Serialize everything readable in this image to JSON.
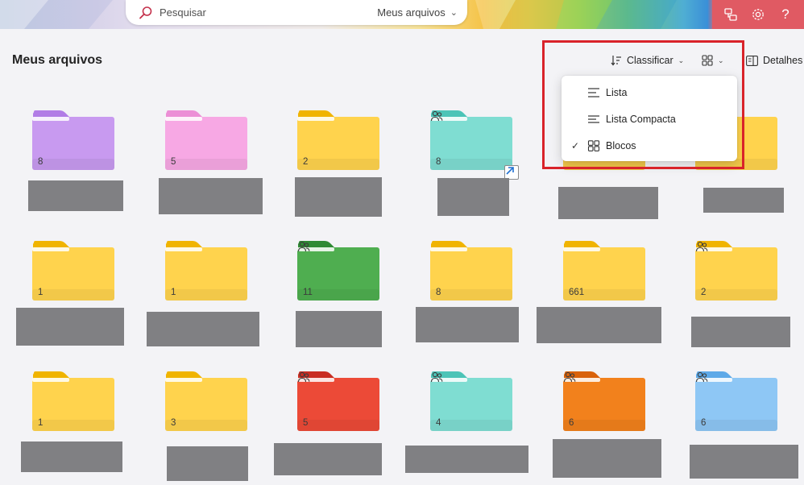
{
  "header": {
    "search_placeholder": "Pesquisar",
    "search_scope": "Meus arquivos",
    "actions": [
      "share-feedback-icon",
      "gear-icon",
      "help-icon"
    ]
  },
  "page": {
    "title": "Meus arquivos"
  },
  "commands": {
    "sort_label": "Classificar",
    "details_label": "Detalhes"
  },
  "view_menu": {
    "items": [
      {
        "label": "Lista",
        "icon": "list-icon",
        "checked": false
      },
      {
        "label": "Lista Compacta",
        "icon": "compact-list-icon",
        "checked": false
      },
      {
        "label": "Blocos",
        "icon": "tiles-icon",
        "checked": true
      }
    ]
  },
  "folders": [
    {
      "count": "8",
      "color": "#c89af0",
      "tab": "#b27de6",
      "shared": false
    },
    {
      "count": "5",
      "color": "#f7a8e4",
      "tab": "#ec8fd6",
      "shared": false
    },
    {
      "count": "2",
      "color": "#ffd34d",
      "tab": "#f0b400",
      "shared": false
    },
    {
      "count": "8",
      "color": "#7fddd2",
      "tab": "#4cc4b7",
      "shared": true,
      "shortcut": true
    },
    {
      "count": "",
      "color": "#ffd34d",
      "tab": "#f0b400",
      "shared": false
    },
    {
      "count": "",
      "color": "#ffd34d",
      "tab": "#f0b400",
      "shared": false
    },
    {
      "count": "1",
      "color": "#ffd34d",
      "tab": "#f0b400",
      "shared": false
    },
    {
      "count": "1",
      "color": "#ffd34d",
      "tab": "#f0b400",
      "shared": false
    },
    {
      "count": "11",
      "color": "#4fae50",
      "tab": "#2e8a34",
      "shared": true
    },
    {
      "count": "8",
      "color": "#ffd34d",
      "tab": "#f0b400",
      "shared": false
    },
    {
      "count": "661",
      "color": "#ffd34d",
      "tab": "#f0b400",
      "shared": false
    },
    {
      "count": "2",
      "color": "#ffd34d",
      "tab": "#f0b400",
      "shared": true
    },
    {
      "count": "1",
      "color": "#ffd34d",
      "tab": "#f0b400",
      "shared": false
    },
    {
      "count": "3",
      "color": "#ffd34d",
      "tab": "#f0b400",
      "shared": false
    },
    {
      "count": "5",
      "color": "#ec4a37",
      "tab": "#c92d22",
      "shared": true
    },
    {
      "count": "4",
      "color": "#7fddd2",
      "tab": "#4cc4b7",
      "shared": true
    },
    {
      "count": "6",
      "color": "#f2811c",
      "tab": "#d9620a",
      "shared": true
    },
    {
      "count": "6",
      "color": "#8ec7f5",
      "tab": "#5ea9e8",
      "shared": true
    }
  ]
}
